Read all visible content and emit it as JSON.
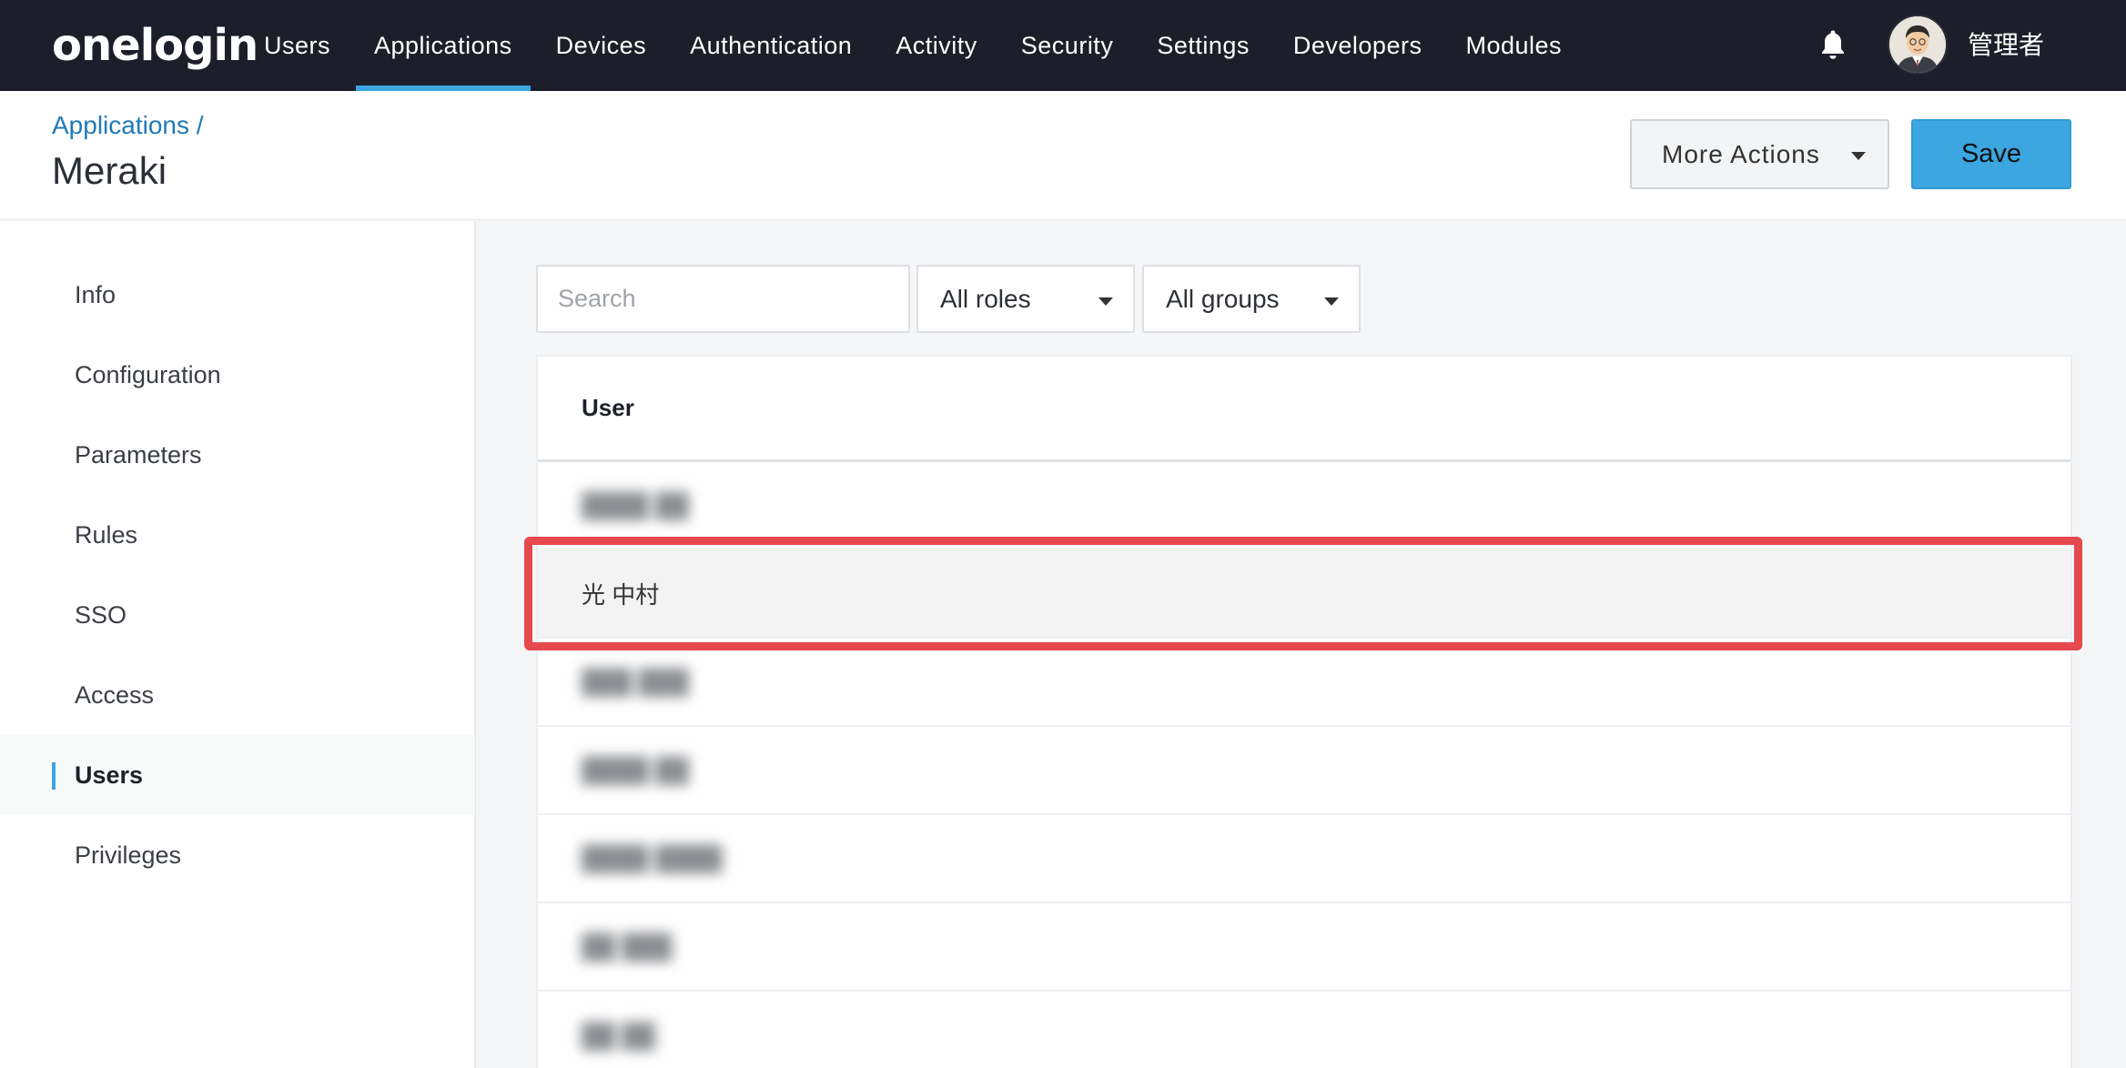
{
  "brand": {
    "logo": "onelogin"
  },
  "nav": {
    "items": [
      {
        "label": "Users"
      },
      {
        "label": "Applications"
      },
      {
        "label": "Devices"
      },
      {
        "label": "Authentication"
      },
      {
        "label": "Activity"
      },
      {
        "label": "Security"
      },
      {
        "label": "Settings"
      },
      {
        "label": "Developers"
      },
      {
        "label": "Modules"
      }
    ],
    "active": "Applications",
    "user_name": "管理者"
  },
  "header": {
    "breadcrumb": "Applications /",
    "title": "Meraki",
    "more_actions_label": "More Actions",
    "save_label": "Save"
  },
  "sidebar": {
    "items": [
      {
        "label": "Info"
      },
      {
        "label": "Configuration"
      },
      {
        "label": "Parameters"
      },
      {
        "label": "Rules"
      },
      {
        "label": "SSO"
      },
      {
        "label": "Access"
      },
      {
        "label": "Users"
      },
      {
        "label": "Privileges"
      }
    ],
    "active": "Users"
  },
  "filters": {
    "search_placeholder": "Search",
    "search_value": "",
    "roles_selected": "All roles",
    "groups_selected": "All groups"
  },
  "table": {
    "column_user": "User",
    "rows": [
      {
        "user": "████ ██",
        "blurred": true
      },
      {
        "user": "光 中村",
        "blurred": false,
        "selected": true
      },
      {
        "user": "███ ███",
        "blurred": true
      },
      {
        "user": "████ ██",
        "blurred": true
      },
      {
        "user": "████ ████",
        "blurred": true
      },
      {
        "user": "██ ███",
        "blurred": true
      },
      {
        "user": "██ ██",
        "blurred": true
      }
    ]
  },
  "colors": {
    "nav_bg": "#1c1f2a",
    "accent": "#3ba6e0",
    "highlight": "#e5484d",
    "link": "#1f7ab7"
  }
}
